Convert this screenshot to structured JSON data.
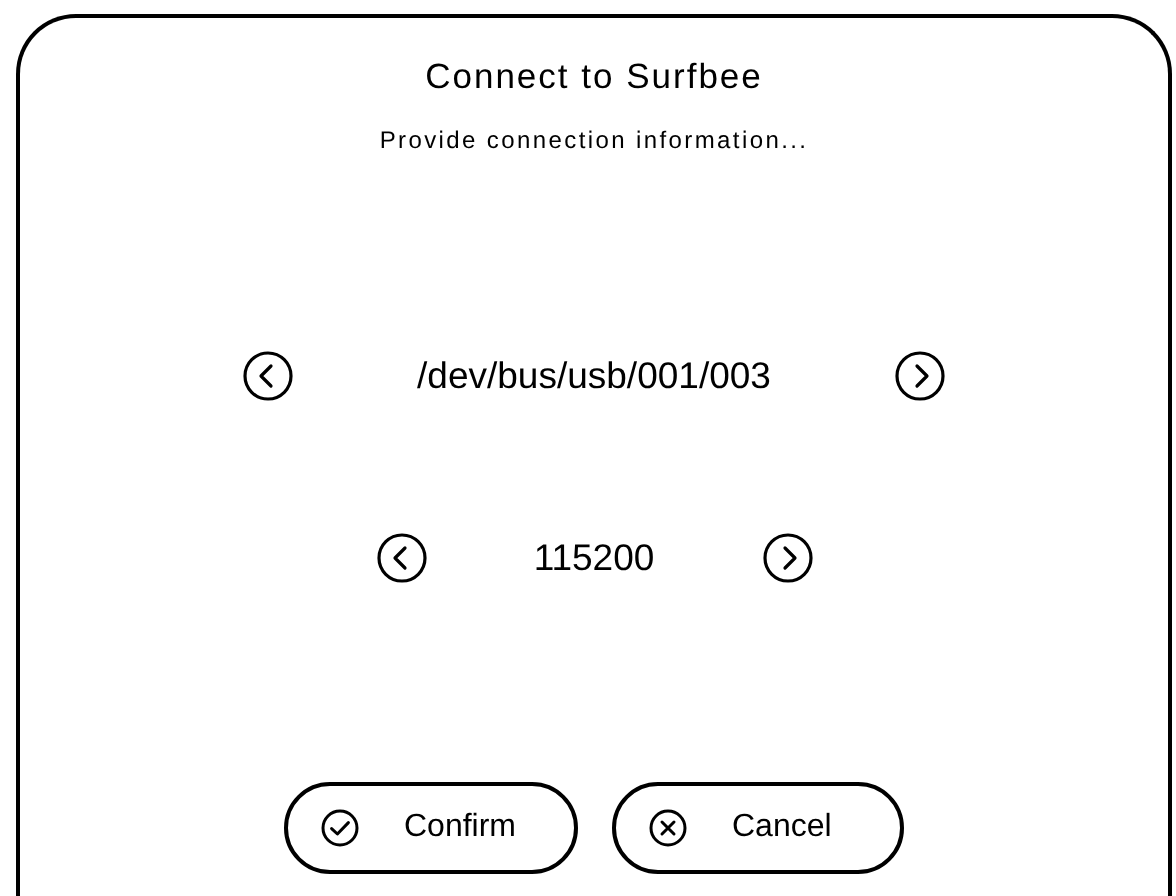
{
  "dialog": {
    "title": "Connect to Surfbee",
    "subtitle": "Provide connection information..."
  },
  "selectors": [
    {
      "value": "/dev/bus/usb/001/003"
    },
    {
      "value": "115200"
    }
  ],
  "buttons": [
    {
      "label": "Confirm",
      "kind": "confirm"
    },
    {
      "label": "Cancel",
      "kind": "cancel"
    }
  ]
}
